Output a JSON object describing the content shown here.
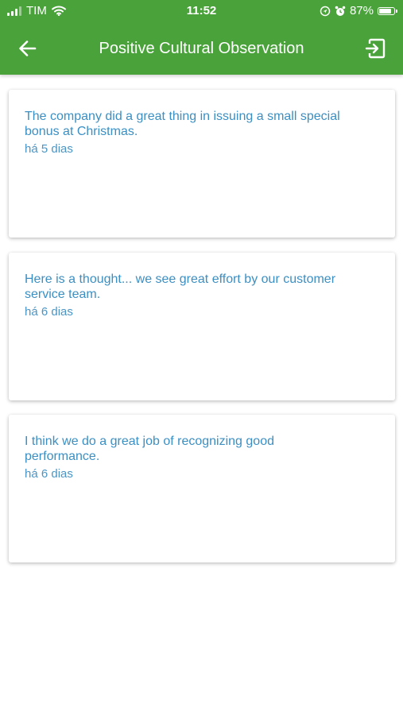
{
  "status_bar": {
    "carrier": "TIM",
    "time": "11:52",
    "battery_percent": "87%",
    "battery_level": 0.87,
    "icons": [
      "signal-icon",
      "wifi-icon",
      "location-lock-icon",
      "alarm-icon",
      "battery-icon"
    ]
  },
  "header": {
    "title": "Positive Cultural Observation",
    "back_icon": "arrow-left-icon",
    "exit_icon": "exit-icon",
    "background_color": "#4aa33a"
  },
  "observations": [
    {
      "text": "The company did a great thing in issuing a small special bonus at Christmas.",
      "time": "há 5 dias"
    },
    {
      "text": "Here is a thought... we see great effort by our customer service team.",
      "time": "há 6 dias"
    },
    {
      "text": "I think we do a great job of recognizing good performance.",
      "time": "há 6 dias"
    }
  ],
  "colors": {
    "accent": "#4aa33a",
    "text": "#3b8fc3"
  }
}
